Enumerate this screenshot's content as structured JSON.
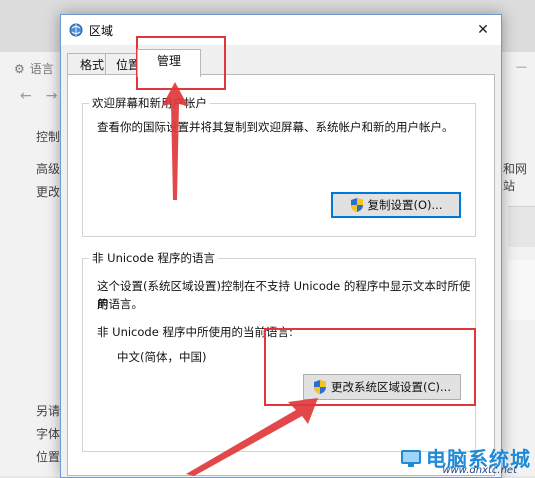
{
  "background_window": {
    "title": "语言",
    "sidebar_items": [
      "控制面",
      "高级设",
      "更改",
      "另请",
      "字体",
      "位置"
    ],
    "right_text": "和网站"
  },
  "dialog": {
    "title": "区域",
    "tabs": [
      "格式",
      "位置",
      "管理"
    ],
    "active_tab": "管理",
    "welcome_group": {
      "legend": "欢迎屏幕和新用户帐户",
      "description": "查看你的国际设置并将其复制到欢迎屏幕、系统帐户和新的用户帐户。",
      "button_label": "复制设置(O)..."
    },
    "unicode_group": {
      "legend": "非 Unicode 程序的语言",
      "description_line1": "这个设置(系统区域设置)控制在不支持 Unicode 的程序中显示文本时所使用",
      "description_line2": "的语言。",
      "current_label": "非 Unicode 程序中所使用的当前语言:",
      "current_value": "中文(简体，中国)",
      "button_label": "更改系统区域设置(C)..."
    }
  },
  "watermark": {
    "brand": "电脑系统城",
    "url": "www.dnxtc.net"
  },
  "colors": {
    "annotation_red": "#e0383a",
    "focus_blue": "#0078d7",
    "dialog_border": "#6f9bd1"
  }
}
